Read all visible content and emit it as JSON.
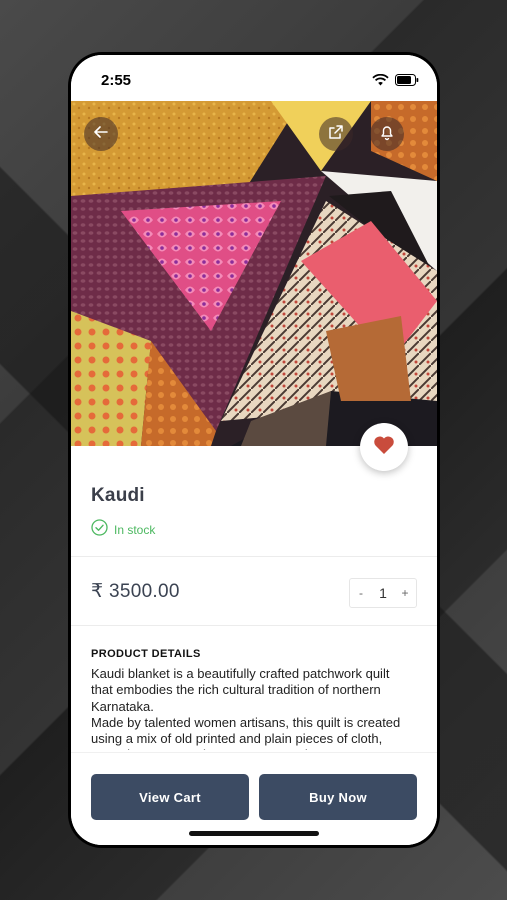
{
  "status_bar": {
    "time": "2:55"
  },
  "icons": {
    "back": "arrow-left-icon",
    "share": "share-icon",
    "notify": "bell-icon",
    "favorite": "heart-icon",
    "stock": "check-circle-icon",
    "wifi": "wifi-icon",
    "battery": "battery-icon"
  },
  "product": {
    "name": "Kaudi",
    "stock_status": "In stock",
    "price": "₹ 3500.00",
    "quantity": {
      "decrement": "-",
      "value": "1",
      "increment": "+"
    }
  },
  "details": {
    "heading": "PRODUCT DETAILS",
    "paragraphs": [
      "Kaudi blanket is a beautifully crafted patchwork quilt that embodies the rich cultural tradition of northern Karnataka.",
      "Made by talented women artisans, this quilt is created using a mix of old printed and plain pieces of cloth, expertly sewn together to create a unique"
    ]
  },
  "actions": {
    "view_cart": "View Cart",
    "buy_now": "Buy Now"
  },
  "colors": {
    "button": "#3c4b63",
    "in_stock": "#4cb860",
    "heart": "#c94c3c"
  }
}
